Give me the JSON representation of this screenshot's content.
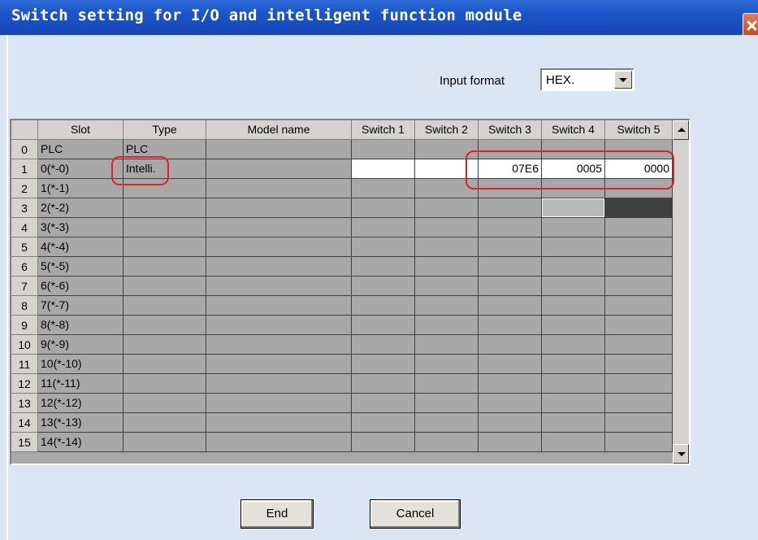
{
  "window": {
    "title": "Switch setting for I/O and intelligent function module",
    "close_icon": "close-icon"
  },
  "input_format": {
    "label": "Input format",
    "value": "HEX."
  },
  "table": {
    "headers": [
      "",
      "Slot",
      "Type",
      "Model name",
      "Switch 1",
      "Switch 2",
      "Switch 3",
      "Switch 4",
      "Switch 5"
    ],
    "rows": [
      {
        "no": "0",
        "slot": "PLC",
        "type": "PLC",
        "model": "",
        "sw1": "",
        "sw2": "",
        "sw3": "",
        "sw4": "",
        "sw5": ""
      },
      {
        "no": "1",
        "slot": "0(*-0)",
        "type": "Intelli.",
        "model": "",
        "sw1": "",
        "sw2": "",
        "sw3": "07E6",
        "sw4": "0005",
        "sw5": "0000"
      },
      {
        "no": "2",
        "slot": "1(*-1)",
        "type": "",
        "model": "",
        "sw1": "",
        "sw2": "",
        "sw3": "",
        "sw4": "",
        "sw5": ""
      },
      {
        "no": "3",
        "slot": "2(*-2)",
        "type": "",
        "model": "",
        "sw1": "",
        "sw2": "",
        "sw3": "",
        "sw4": "",
        "sw5": ""
      },
      {
        "no": "4",
        "slot": "3(*-3)",
        "type": "",
        "model": "",
        "sw1": "",
        "sw2": "",
        "sw3": "",
        "sw4": "",
        "sw5": ""
      },
      {
        "no": "5",
        "slot": "4(*-4)",
        "type": "",
        "model": "",
        "sw1": "",
        "sw2": "",
        "sw3": "",
        "sw4": "",
        "sw5": ""
      },
      {
        "no": "6",
        "slot": "5(*-5)",
        "type": "",
        "model": "",
        "sw1": "",
        "sw2": "",
        "sw3": "",
        "sw4": "",
        "sw5": ""
      },
      {
        "no": "7",
        "slot": "6(*-6)",
        "type": "",
        "model": "",
        "sw1": "",
        "sw2": "",
        "sw3": "",
        "sw4": "",
        "sw5": ""
      },
      {
        "no": "8",
        "slot": "7(*-7)",
        "type": "",
        "model": "",
        "sw1": "",
        "sw2": "",
        "sw3": "",
        "sw4": "",
        "sw5": ""
      },
      {
        "no": "9",
        "slot": "8(*-8)",
        "type": "",
        "model": "",
        "sw1": "",
        "sw2": "",
        "sw3": "",
        "sw4": "",
        "sw5": ""
      },
      {
        "no": "10",
        "slot": "9(*-9)",
        "type": "",
        "model": "",
        "sw1": "",
        "sw2": "",
        "sw3": "",
        "sw4": "",
        "sw5": ""
      },
      {
        "no": "11",
        "slot": "10(*-10)",
        "type": "",
        "model": "",
        "sw1": "",
        "sw2": "",
        "sw3": "",
        "sw4": "",
        "sw5": ""
      },
      {
        "no": "12",
        "slot": "11(*-11)",
        "type": "",
        "model": "",
        "sw1": "",
        "sw2": "",
        "sw3": "",
        "sw4": "",
        "sw5": ""
      },
      {
        "no": "13",
        "slot": "12(*-12)",
        "type": "",
        "model": "",
        "sw1": "",
        "sw2": "",
        "sw3": "",
        "sw4": "",
        "sw5": ""
      },
      {
        "no": "14",
        "slot": "13(*-13)",
        "type": "",
        "model": "",
        "sw1": "",
        "sw2": "",
        "sw3": "",
        "sw4": "",
        "sw5": ""
      },
      {
        "no": "15",
        "slot": "14(*-14)",
        "type": "",
        "model": "",
        "sw1": "",
        "sw2": "",
        "sw3": "",
        "sw4": "",
        "sw5": ""
      }
    ]
  },
  "buttons": {
    "end": "End",
    "cancel": "Cancel"
  },
  "colors": {
    "title_bar": "#1c56c8",
    "dialog_bg": "#dbe6f5",
    "highlight": "#e0202a",
    "grid_bg": "#a8a8a8"
  }
}
